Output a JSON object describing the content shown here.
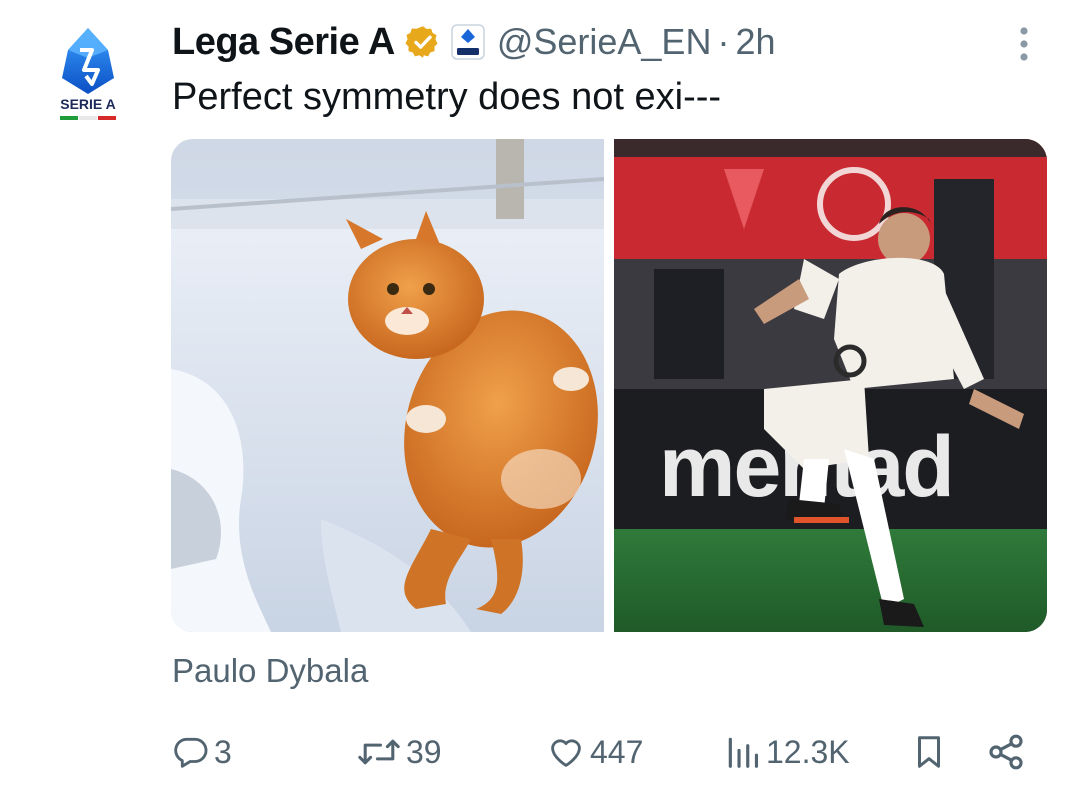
{
  "account": {
    "display_name": "Lega Serie A",
    "handle": "@SerieA_EN",
    "separator": "·",
    "time": "2h",
    "logo_text": "SERIE A"
  },
  "tweet": {
    "text": "Perfect symmetry does not exi---",
    "caption": "Paulo Dybala",
    "images": [
      {
        "icon": "orange-cat-leaping-in-snow"
      },
      {
        "icon": "footballer-kicking-ball",
        "board_text": "mentad"
      }
    ]
  },
  "actions": {
    "replies": "3",
    "retweets": "39",
    "likes": "447",
    "views": "12.3K"
  },
  "colors": {
    "text": "#0f1419",
    "muted": "#536471",
    "verified_gold": "#e7a91b",
    "serie_a_blue": "#1a66d9"
  }
}
